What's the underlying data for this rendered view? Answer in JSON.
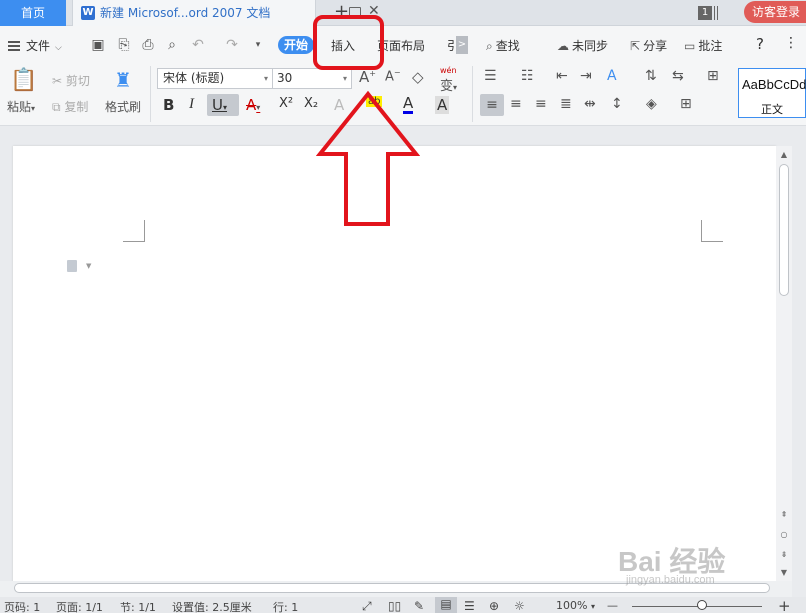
{
  "titlebar": {
    "home_tab": "首页",
    "doc_tab_title": "新建 Microsof...ord 2007 文档",
    "doc_icon_letter": "W",
    "add_tab": "+",
    "tab_count": "1",
    "login_button": "访客登录"
  },
  "menu": {
    "file": "文件",
    "tab_start": "开始",
    "tab_insert": "插入",
    "tab_layout": "页面布局",
    "tab_ref": "引",
    "tab_scroll": ">",
    "find": "查找",
    "sync": "未同步",
    "share": "分享",
    "comment": "批注",
    "help": "?",
    "more": "⋮"
  },
  "ribbon": {
    "paste": "粘贴",
    "cut": "剪切",
    "copy": "复制",
    "format_painter": "格式刷",
    "font_name": "宋体 (标题)",
    "font_size": "30",
    "bold": "B",
    "italic": "I",
    "underline": "U",
    "strike": "A",
    "superscript": "X²",
    "subscript": "X₂",
    "highlight": "ab",
    "font_color": "A",
    "char_shade": "A",
    "phonetic": "wén",
    "increase_font": "A",
    "decrease_font": "A",
    "style_sample": "AaBbCcDd",
    "style_name": "正文"
  },
  "status": {
    "page_num": "页码: 1",
    "pages": "页面: 1/1",
    "section": "节: 1/1",
    "setting": "设置值: 2.5厘米",
    "line": "行: 1",
    "zoom": "100%",
    "zoom_minus": "—",
    "zoom_plus": "+"
  },
  "watermark": {
    "text": "Bai 经验",
    "sub": "jingyan.baidu.com"
  },
  "colors": {
    "accent": "#3d8ef0",
    "login": "#e05b57",
    "annotation": "#e2141c"
  }
}
